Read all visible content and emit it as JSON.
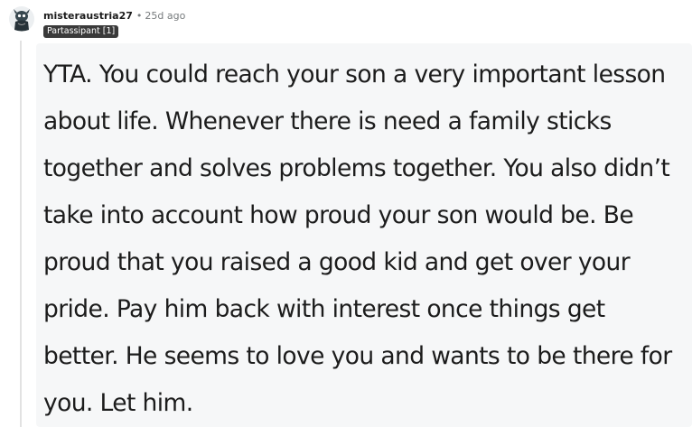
{
  "comment": {
    "username": "misteraustria27",
    "separator": "•",
    "timestamp": "25d ago",
    "flair": "Partassipant [1]",
    "avatar_icon": "snoo-avatar-icon",
    "body": "YTA. You could reach your son a very important lesson about life. Whenever there is need a family sticks together and solves problems together. You also didn’t take into account how proud your son would be. Be proud that you raised a good kid and get over your pride. Pay him back with interest once things get better. He seems to love you and wants to be there for you. Let him."
  },
  "colors": {
    "flair_background": "#3a3a3a",
    "body_background": "#f6f7f8",
    "muted_text": "#787c7e"
  }
}
